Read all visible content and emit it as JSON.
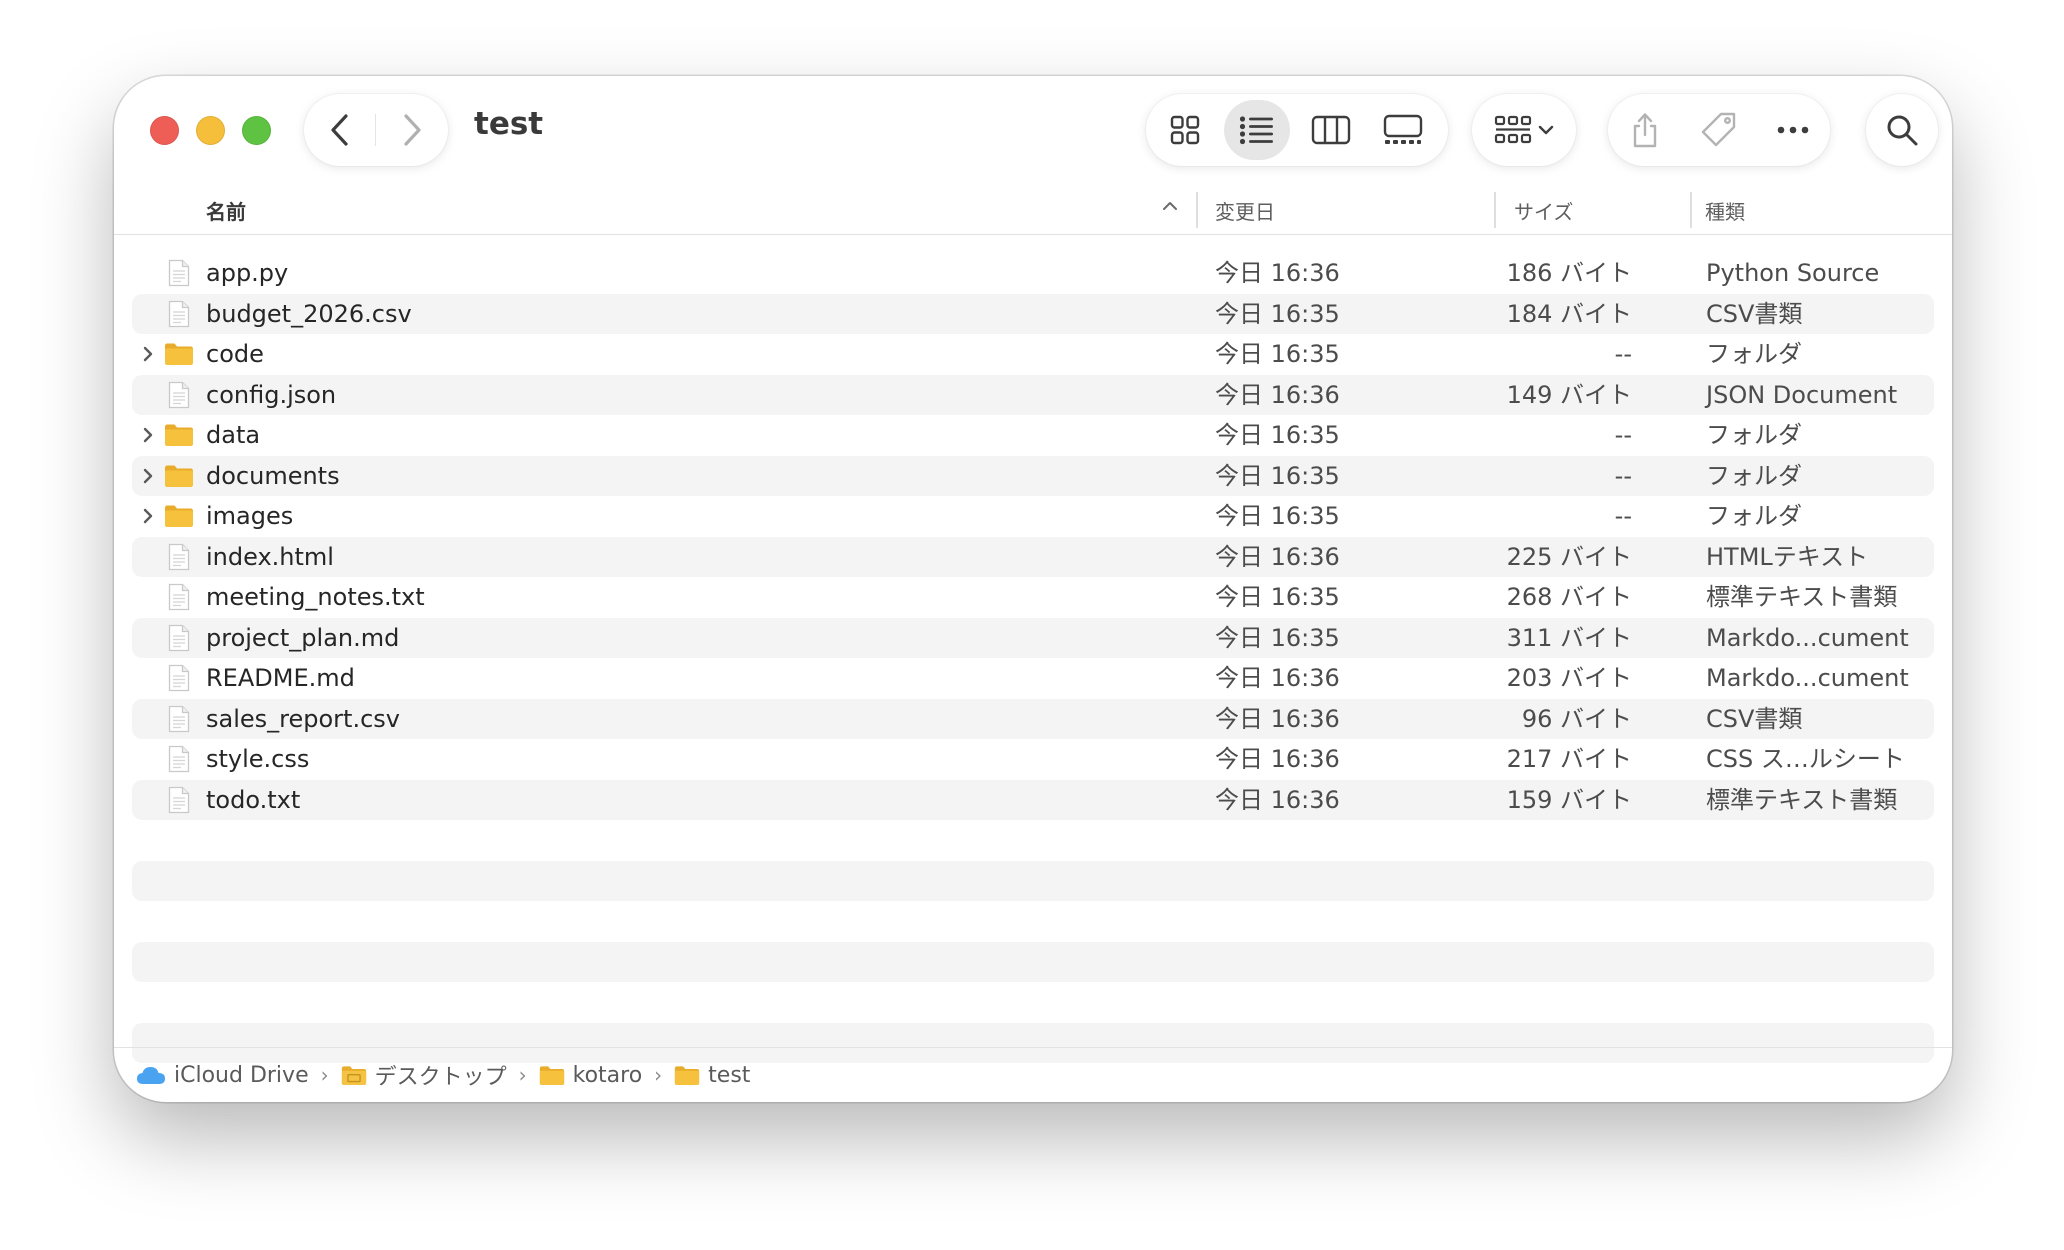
{
  "window": {
    "title": "test"
  },
  "toolbar": {
    "view_modes": [
      "icon-view",
      "list-view",
      "column-view",
      "gallery-view"
    ],
    "active_view": "list-view"
  },
  "columns": {
    "name": "名前",
    "date": "変更日",
    "size": "サイズ",
    "kind": "種類"
  },
  "files": [
    {
      "name": "app.py",
      "date": "今日 16:36",
      "size": "186 バイト",
      "kind": "Python Source",
      "type": "file"
    },
    {
      "name": "budget_2026.csv",
      "date": "今日 16:35",
      "size": "184 バイト",
      "kind": "CSV書類",
      "type": "file"
    },
    {
      "name": "code",
      "date": "今日 16:35",
      "size": "--",
      "kind": "フォルダ",
      "type": "folder"
    },
    {
      "name": "config.json",
      "date": "今日 16:36",
      "size": "149 バイト",
      "kind": "JSON Document",
      "type": "file"
    },
    {
      "name": "data",
      "date": "今日 16:35",
      "size": "--",
      "kind": "フォルダ",
      "type": "folder"
    },
    {
      "name": "documents",
      "date": "今日 16:35",
      "size": "--",
      "kind": "フォルダ",
      "type": "folder"
    },
    {
      "name": "images",
      "date": "今日 16:35",
      "size": "--",
      "kind": "フォルダ",
      "type": "folder"
    },
    {
      "name": "index.html",
      "date": "今日 16:36",
      "size": "225 バイト",
      "kind": "HTMLテキスト",
      "type": "file"
    },
    {
      "name": "meeting_notes.txt",
      "date": "今日 16:35",
      "size": "268 バイト",
      "kind": "標準テキスト書類",
      "type": "file"
    },
    {
      "name": "project_plan.md",
      "date": "今日 16:35",
      "size": "311 バイト",
      "kind": "Markdo...cument",
      "type": "file"
    },
    {
      "name": "README.md",
      "date": "今日 16:36",
      "size": "203 バイト",
      "kind": "Markdo...cument",
      "type": "file"
    },
    {
      "name": "sales_report.csv",
      "date": "今日 16:36",
      "size": "96 バイト",
      "kind": "CSV書類",
      "type": "file"
    },
    {
      "name": "style.css",
      "date": "今日 16:36",
      "size": "217 バイト",
      "kind": "CSS ス…ルシート",
      "type": "file"
    },
    {
      "name": "todo.txt",
      "date": "今日 16:36",
      "size": "159 バイト",
      "kind": "標準テキスト書類",
      "type": "file"
    }
  ],
  "pathbar": [
    {
      "label": "iCloud Drive",
      "icon": "cloud-icon"
    },
    {
      "label": "デスクトップ",
      "icon": "desktop-folder-icon"
    },
    {
      "label": "kotaro",
      "icon": "folder-icon"
    },
    {
      "label": "test",
      "icon": "folder-icon"
    }
  ],
  "colors": {
    "close": "#ee5e57",
    "minimize": "#f5be3b",
    "zoom": "#5ec342",
    "folder": "#f6c23e",
    "stripe": "#f4f4f4"
  }
}
